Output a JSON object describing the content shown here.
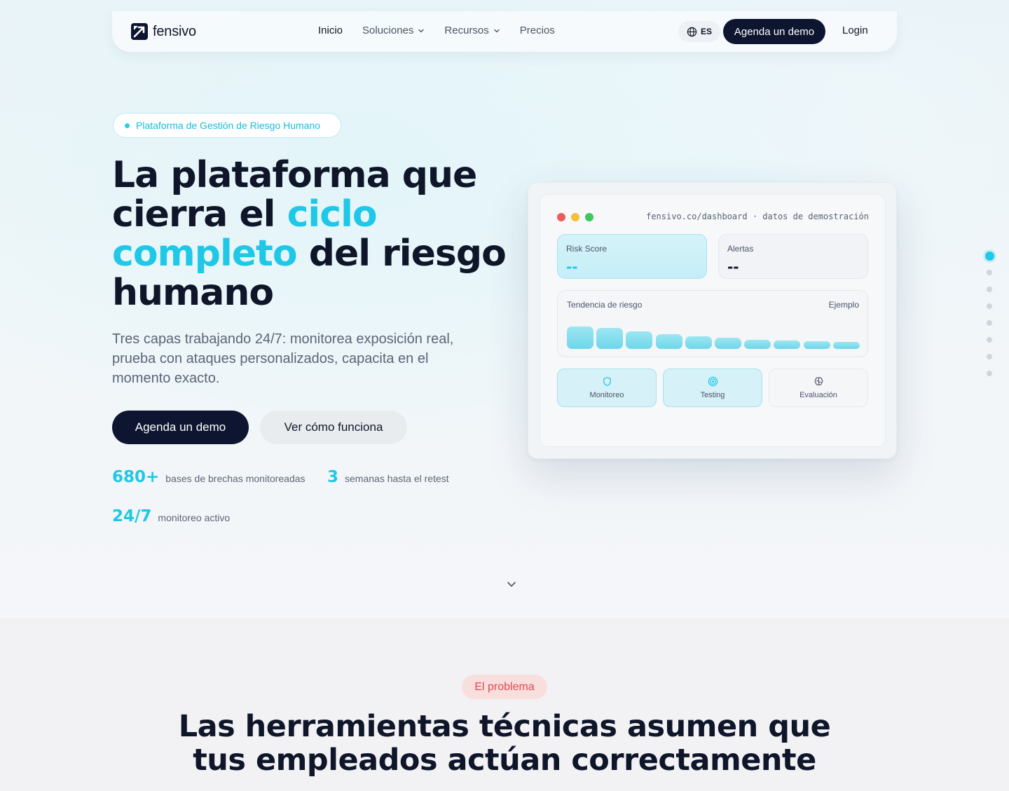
{
  "nav": {
    "brand": "fensivo",
    "links": [
      {
        "label": "Inicio"
      },
      {
        "label": "Soluciones"
      },
      {
        "label": "Recursos"
      },
      {
        "label": "Precios"
      }
    ],
    "lang": "ES",
    "cta": "Agenda un demo",
    "login": "Login"
  },
  "hero": {
    "badge": "Plataforma de Gestión de Riesgo Humano",
    "title_1": "La plataforma que cierra el ",
    "title_accent": "ciclo completo",
    "title_2": " del riesgo humano",
    "subtitle": "Tres capas trabajando 24/7: monitorea exposición real, prueba con ataques personalizados, capacita en el momento exacto.",
    "primary_cta": "Agenda un demo",
    "secondary_cta": "Ver cómo funciona",
    "stats": [
      {
        "value": "680+",
        "label": "bases de brechas monitoreadas"
      },
      {
        "value": "3",
        "label": "semanas hasta el retest"
      },
      {
        "value": "24/7",
        "label": "monitoreo activo"
      }
    ]
  },
  "dashboard": {
    "url": "fensivo.co/dashboard · datos de demostración",
    "risk_score": {
      "label": "Risk Score",
      "value": "--"
    },
    "alerts": {
      "label": "Alertas",
      "value": "--"
    },
    "trend": {
      "label": "Tendencia de riesgo",
      "tag": "Ejemplo"
    },
    "trend_values": [
      32,
      30,
      25,
      21,
      18,
      16,
      13,
      12,
      11,
      10
    ],
    "modules": [
      {
        "label": "Monitoreo",
        "icon": "shield-icon"
      },
      {
        "label": "Testing",
        "icon": "target-icon"
      },
      {
        "label": "Evaluación",
        "icon": "brain-icon"
      }
    ],
    "colors": {
      "close": "#ee5b5b",
      "minimize": "#f4bf3c",
      "maximize": "#3ec85a",
      "accent": "#1ec8e6"
    }
  },
  "problem": {
    "tag": "El problema",
    "title": "Las herramientas técnicas asumen que tus empleados actúan correctamente"
  }
}
